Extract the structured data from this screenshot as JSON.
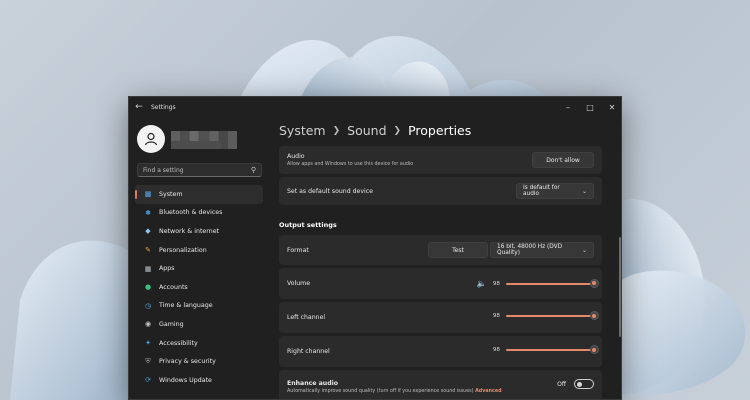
{
  "window": {
    "title": "Settings"
  },
  "profile": {
    "name_redacted": ""
  },
  "search": {
    "placeholder": "Find a setting"
  },
  "sidebar": {
    "items": [
      {
        "label": "System",
        "icon": "monitor-icon",
        "active": true
      },
      {
        "label": "Bluetooth & devices",
        "icon": "bluetooth-icon"
      },
      {
        "label": "Network & internet",
        "icon": "network-icon"
      },
      {
        "label": "Personalization",
        "icon": "brush-icon"
      },
      {
        "label": "Apps",
        "icon": "apps-icon"
      },
      {
        "label": "Accounts",
        "icon": "accounts-icon"
      },
      {
        "label": "Time & language",
        "icon": "globe-clock-icon"
      },
      {
        "label": "Gaming",
        "icon": "gamepad-icon"
      },
      {
        "label": "Accessibility",
        "icon": "accessibility-icon"
      },
      {
        "label": "Privacy & security",
        "icon": "shield-icon"
      },
      {
        "label": "Windows Update",
        "icon": "update-icon"
      }
    ]
  },
  "breadcrumb": {
    "level1": "System",
    "level2": "Sound",
    "current": "Properties"
  },
  "audio_card": {
    "label": "Audio",
    "sub": "Allow apps and Windows to use this device for audio",
    "button": "Don't allow"
  },
  "default_card": {
    "label": "Set as default sound device",
    "select": "Is default for audio"
  },
  "output": {
    "section_title": "Output settings",
    "format": {
      "label": "Format",
      "test_button": "Test",
      "select": "16 bit, 48000 Hz (DVD Quality)"
    },
    "volume": {
      "label": "Volume",
      "value": "98",
      "level": 0.98
    },
    "left": {
      "label": "Left channel",
      "value": "98",
      "level": 0.98
    },
    "right": {
      "label": "Right channel",
      "value": "98",
      "level": 0.98
    }
  },
  "enhance": {
    "label": "Enhance audio",
    "sub": "Automatically improve sound quality (turn off if you experience sound issues)",
    "link": "Advanced",
    "toggle_label": "Off"
  },
  "colors": {
    "accent": "#e38a6b",
    "window_bg": "#202020",
    "card_bg": "#2b2b2b"
  }
}
